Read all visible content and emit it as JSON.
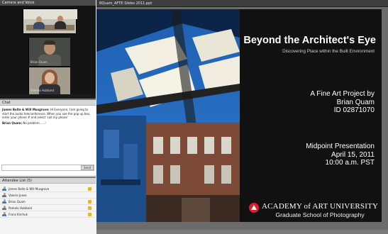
{
  "camera_panel": {
    "title": "Camera and Voice",
    "feeds": [
      {
        "name": ""
      },
      {
        "name": "Brian Quam"
      },
      {
        "name": "Pamela Hubbard"
      }
    ]
  },
  "chat": {
    "title": "Chat",
    "messages": [
      {
        "sender": "James Bolte & Will Musgrove:",
        "text": "Hi Everyone, I am going to start the audio teleconference. When you see the pop up box, enter your phone # and select 'call my phone'"
      },
      {
        "sender": "Brian Quam:",
        "text": "No problem......!"
      }
    ],
    "send_label": "Send"
  },
  "attendees": {
    "title": "Attendee List (5)",
    "list": [
      {
        "name": "James Bolte & Will Musgrove"
      },
      {
        "name": "Valerie Jones"
      },
      {
        "name": "Brian Quam"
      },
      {
        "name": "Pamela Hubbard"
      },
      {
        "name": "Franz Kirchuk"
      }
    ]
  },
  "document": {
    "filename": "BQuam_AFTE-Slides 2011.ppt"
  },
  "slide": {
    "title": "Beyond the Architect's Eye",
    "subtitle": "Discovering Place within the Built Environment",
    "project_line1": "A Fine Art Project by",
    "project_line2": "Brian Quam",
    "project_line3": "ID 02871070",
    "event_line1": "Midpoint Presentation",
    "event_line2": "April 15, 2011",
    "event_line3": "10:00 a.m. PST",
    "logo_text": "ACADEMY of ART UNIVERSITY",
    "logo_sub": "Graduate School of Photography"
  },
  "colors": {
    "accent_red": "#d9202c",
    "status_yellow": "#e7b32d"
  }
}
